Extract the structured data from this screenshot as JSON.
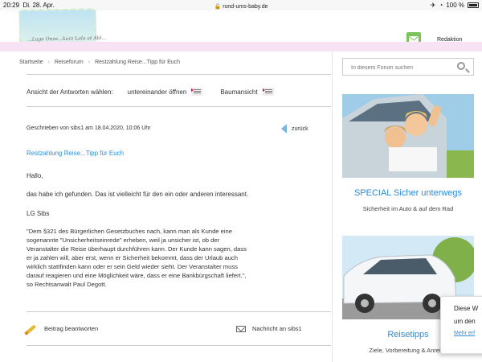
{
  "status_bar": {
    "time": "20:29",
    "date": "Di. 28. Apr.",
    "url": "rund-ums-baby.de",
    "battery": "100 %"
  },
  "header": {
    "logo_text": "...Lage Onze...kurz Lalo at Abl...",
    "redaktion_label": "Redaktion"
  },
  "breadcrumb": [
    "Startseite",
    "Reiseforum",
    "Restzahlung Reise...Tipp für Euch"
  ],
  "answer_view": {
    "label": "Ansicht der Antworten wählen:",
    "option1": "untereinander öffnen",
    "option2": "Baumansicht"
  },
  "post": {
    "meta": "Geschrieben von sibs1 am 18.04.2020, 10:06 Uhr",
    "back_label": "zurück",
    "title": "Restzahlung Reise...Tipp für Euch",
    "greeting": "Hallo,",
    "line1": "das habe ich gefunden. Das ist vielleicht für den ein oder anderen interessant.",
    "signoff": "LG Sibs",
    "quote_lines": [
      "\"Dem §321 des Bürgerlichen Gesetzbuches nach, kann man als Kunde eine",
      "sogenannte \"Unsicherheitseinrede\" erheben, weil ja unsicher ist, ob der",
      "Veranstalter die Reise überhaupt durchführen kann. Der Kunde kann sagen, dass",
      "er ja zahlen will, aber erst, wenn er Sicherheit bekommt, dass der Urlaub auch",
      "wirklich stattfinden kann oder er sein Geld wieder sieht. Der Veranstalter muss",
      "darauf reagieren und eine Möglichkeit wäre, dass er eine Bankbürgschaft liefert.\",",
      "so Rechtsanwalt Paul Degott."
    ]
  },
  "actions": {
    "reply_label": "Beitrag beantworten",
    "message_label": "Nachricht an sibs1"
  },
  "sidebar": {
    "search_placeholder": "In diesem Forum suchen",
    "promo1": {
      "title": "SPECIAL Sicher unterwegs",
      "subtitle": "Sicherheit im Auto & auf dem Rad"
    },
    "promo2": {
      "title": "Reisetipps",
      "subtitle": "Ziele, Vorbereitung & Anreise"
    }
  },
  "cookie_popup": {
    "line1": "Diese W",
    "line2": "um den",
    "link": "Mehr erf"
  },
  "colors": {
    "link": "#2d8bd8",
    "mail_button": "#7cc35b",
    "pink_band": "#f7e3f4"
  }
}
